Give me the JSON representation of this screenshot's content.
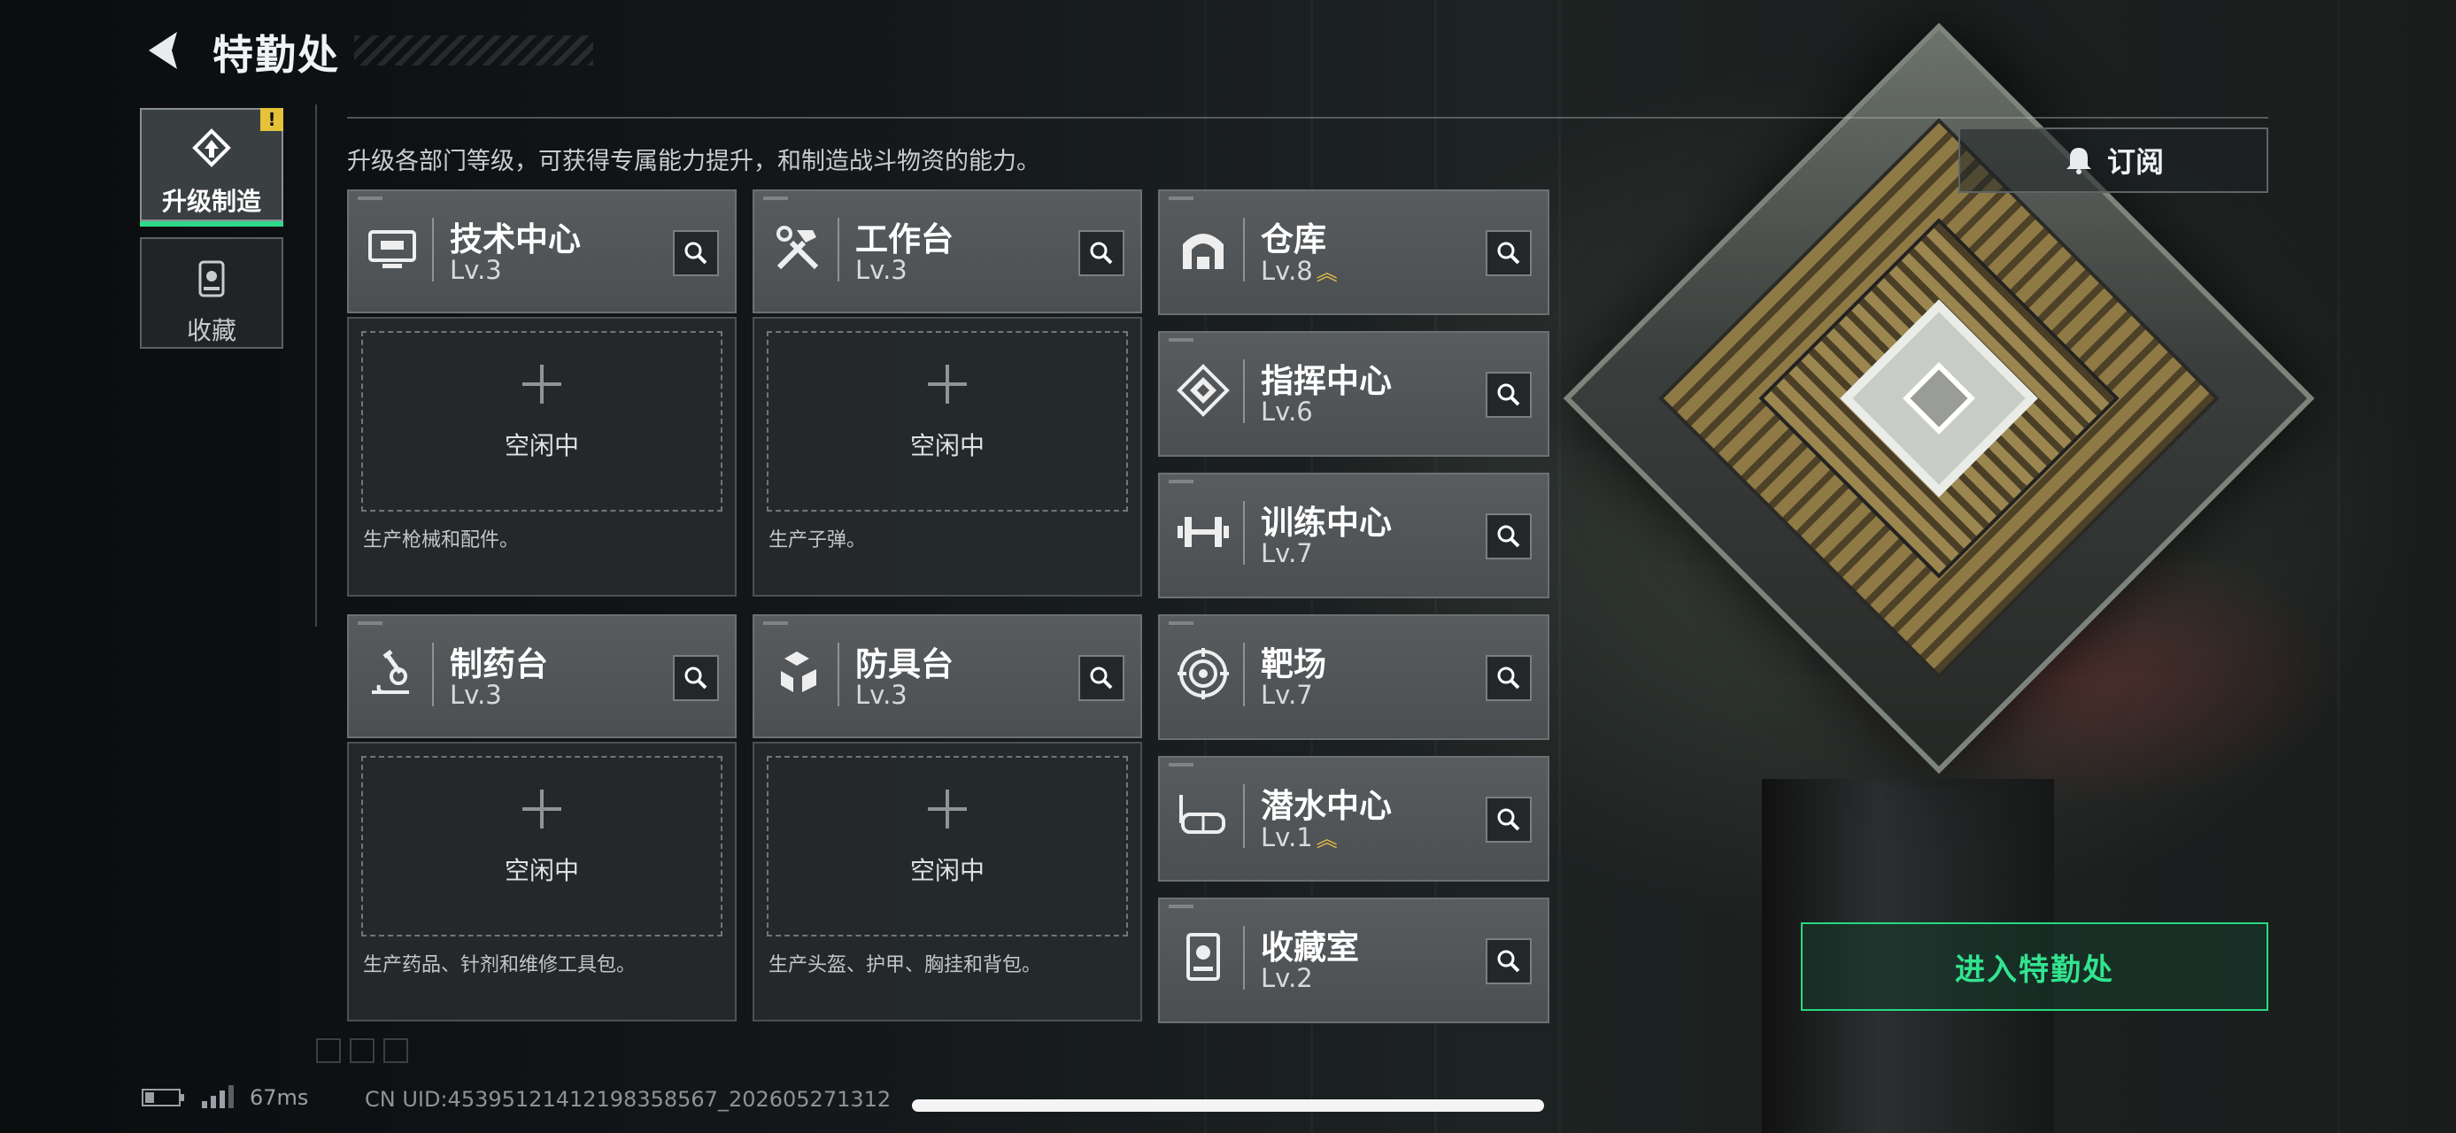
{
  "header": {
    "title": "特勤处",
    "back_icon": "back-arrow-icon"
  },
  "sidebar": {
    "tabs": [
      {
        "label": "升级制造",
        "icon": "upgrade-icon",
        "active": true,
        "badge": "!"
      },
      {
        "label": "收藏",
        "icon": "collection-icon",
        "active": false
      }
    ]
  },
  "description": "升级各部门等级，可获得专属能力提升，和制造战斗物资的能力。",
  "subscribe": {
    "label": "订阅",
    "icon": "bell-icon"
  },
  "departments": [
    {
      "name": "技术中心",
      "level": "Lv.3",
      "icon": "tech-center-icon"
    },
    {
      "name": "工作台",
      "level": "Lv.3",
      "icon": "workbench-icon"
    },
    {
      "name": "仓库",
      "level": "Lv.8",
      "icon": "warehouse-icon",
      "upgradable": true
    },
    {
      "name": "指挥中心",
      "level": "Lv.6",
      "icon": "command-center-icon"
    },
    {
      "name": "训练中心",
      "level": "Lv.7",
      "icon": "training-center-icon"
    },
    {
      "name": "制药台",
      "level": "Lv.3",
      "icon": "pharmacy-icon"
    },
    {
      "name": "防具台",
      "level": "Lv.3",
      "icon": "armor-bench-icon"
    },
    {
      "name": "靶场",
      "level": "Lv.7",
      "icon": "shooting-range-icon"
    },
    {
      "name": "潜水中心",
      "level": "Lv.1",
      "icon": "diving-center-icon",
      "upgradable": true
    },
    {
      "name": "收藏室",
      "level": "Lv.2",
      "icon": "collection-room-icon"
    }
  ],
  "production_slots": [
    {
      "status": "空闲中",
      "produces": "生产枪械和配件。"
    },
    {
      "status": "空闲中",
      "produces": "生产子弹。"
    },
    {
      "status": "空闲中",
      "produces": "生产药品、针剂和维修工具包。"
    },
    {
      "status": "空闲中",
      "produces": "生产头盔、护甲、胸挂和背包。"
    }
  ],
  "enter_button": {
    "label": "进入特勤处"
  },
  "status_bar": {
    "ping": "67ms",
    "uid": "CN UID:4539512141219835856​7_202605271312"
  },
  "colors": {
    "accent_green": "#2fd98a",
    "upgrade_gold": "#e5bd48"
  }
}
